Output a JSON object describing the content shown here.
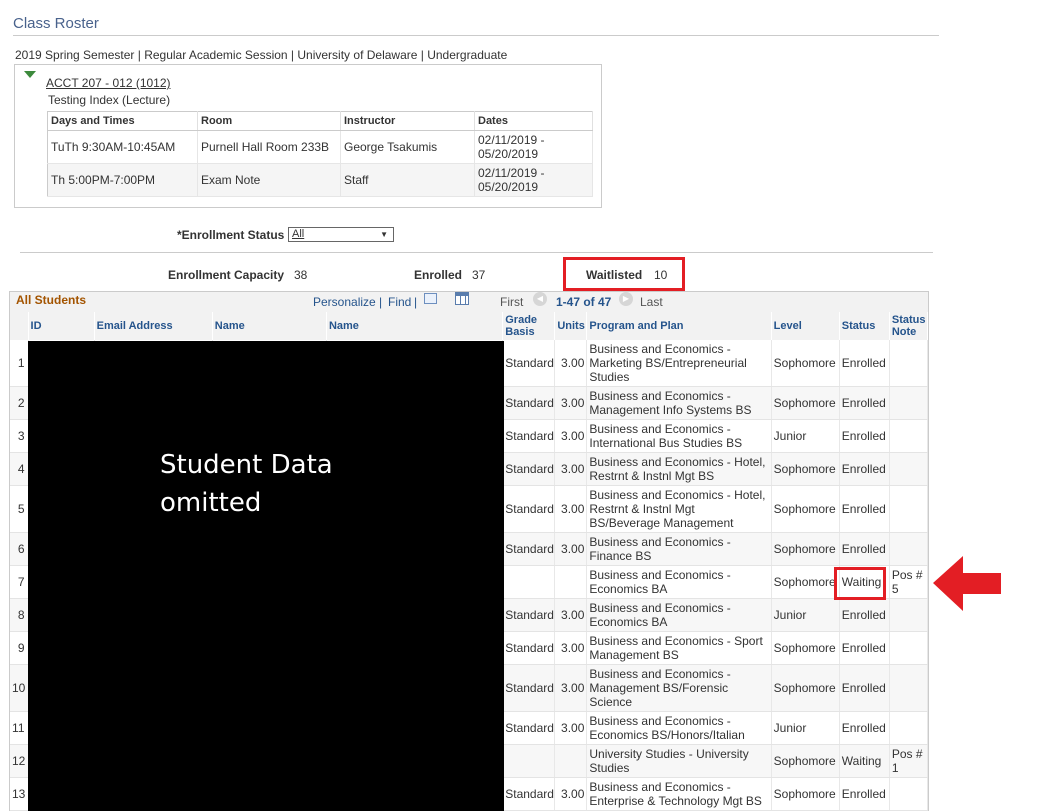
{
  "page": {
    "title": "Class Roster",
    "semester_line": "2019 Spring Semester | Regular Academic Session | University of Delaware | Undergraduate"
  },
  "class": {
    "link": "ACCT 207 - 012 (1012)",
    "description": "Testing Index (Lecture)",
    "meeting_headers": [
      "Days and Times",
      "Room",
      "Instructor",
      "Dates"
    ],
    "meetings": [
      {
        "days_times": "TuTh 9:30AM-10:45AM",
        "room": "Purnell Hall Room 233B",
        "instructor": "George Tsakumis",
        "dates": "02/11/2019 - 05/20/2019"
      },
      {
        "days_times": "Th 5:00PM-7:00PM",
        "room": "Exam Note",
        "instructor": "Staff",
        "dates": "02/11/2019 - 05/20/2019"
      }
    ]
  },
  "filter": {
    "label": "*Enrollment Status",
    "selected": "All"
  },
  "summary": {
    "capacity_label": "Enrollment Capacity",
    "capacity_value": "38",
    "enrolled_label": "Enrolled",
    "enrolled_value": "37",
    "waitlisted_label": "Waitlisted",
    "waitlisted_value": "10"
  },
  "grid": {
    "title": "All Students",
    "personalize": "Personalize",
    "separator": "|",
    "find": "Find",
    "first": "First",
    "range": "1-47 of 47",
    "last": "Last",
    "headers": [
      "",
      "ID",
      "Email Address",
      "Name",
      "Name",
      "Grade Basis",
      "Units",
      "Program and Plan",
      "Level",
      "Status",
      "Status Note"
    ],
    "rows": [
      {
        "num": "1",
        "grade_basis": "Standard",
        "units": "3.00",
        "program": "Business and Economics - Marketing BS/Entrepreneurial Studies",
        "level": "Sophomore",
        "status": "Enrolled",
        "note": ""
      },
      {
        "num": "2",
        "grade_basis": "Standard",
        "units": "3.00",
        "program": "Business and Economics - Management Info Systems BS",
        "level": "Sophomore",
        "status": "Enrolled",
        "note": ""
      },
      {
        "num": "3",
        "grade_basis": "Standard",
        "units": "3.00",
        "program": "Business and Economics - International Bus Studies BS",
        "level": "Junior",
        "status": "Enrolled",
        "note": ""
      },
      {
        "num": "4",
        "grade_basis": "Standard",
        "units": "3.00",
        "program": "Business and Economics - Hotel, Restrnt & Instnl Mgt BS",
        "level": "Sophomore",
        "status": "Enrolled",
        "note": ""
      },
      {
        "num": "5",
        "grade_basis": "Standard",
        "units": "3.00",
        "program": "Business and Economics - Hotel, Restrnt & Instnl Mgt BS/Beverage Management",
        "level": "Sophomore",
        "status": "Enrolled",
        "note": ""
      },
      {
        "num": "6",
        "grade_basis": "Standard",
        "units": "3.00",
        "program": "Business and Economics - Finance BS",
        "level": "Sophomore",
        "status": "Enrolled",
        "note": ""
      },
      {
        "num": "7",
        "grade_basis": "",
        "units": "",
        "program": "Business and Economics - Economics BA",
        "level": "Sophomore",
        "status": "Waiting",
        "note": "Pos # 5"
      },
      {
        "num": "8",
        "grade_basis": "Standard",
        "units": "3.00",
        "program": "Business and Economics - Economics BA",
        "level": "Junior",
        "status": "Enrolled",
        "note": ""
      },
      {
        "num": "9",
        "grade_basis": "Standard",
        "units": "3.00",
        "program": "Business and Economics - Sport Management BS",
        "level": "Sophomore",
        "status": "Enrolled",
        "note": ""
      },
      {
        "num": "10",
        "grade_basis": "Standard",
        "units": "3.00",
        "program": "Business and Economics - Management BS/Forensic Science",
        "level": "Sophomore",
        "status": "Enrolled",
        "note": ""
      },
      {
        "num": "11",
        "grade_basis": "Standard",
        "units": "3.00",
        "program": "Business and Economics - Economics BS/Honors/Italian",
        "level": "Junior",
        "status": "Enrolled",
        "note": ""
      },
      {
        "num": "12",
        "grade_basis": "",
        "units": "",
        "program": "University Studies - University Studies",
        "level": "Sophomore",
        "status": "Waiting",
        "note": "Pos # 1"
      },
      {
        "num": "13",
        "grade_basis": "Standard",
        "units": "3.00",
        "program": "Business and Economics - Enterprise & Technology Mgt BS",
        "level": "Sophomore",
        "status": "Enrolled",
        "note": ""
      }
    ]
  },
  "redaction": {
    "text_line1": "Student Data",
    "text_line2": "omitted"
  },
  "colors": {
    "highlight": "#e31e24",
    "link": "#25548c",
    "grid_title": "#a35400",
    "page_title": "#49628c"
  }
}
